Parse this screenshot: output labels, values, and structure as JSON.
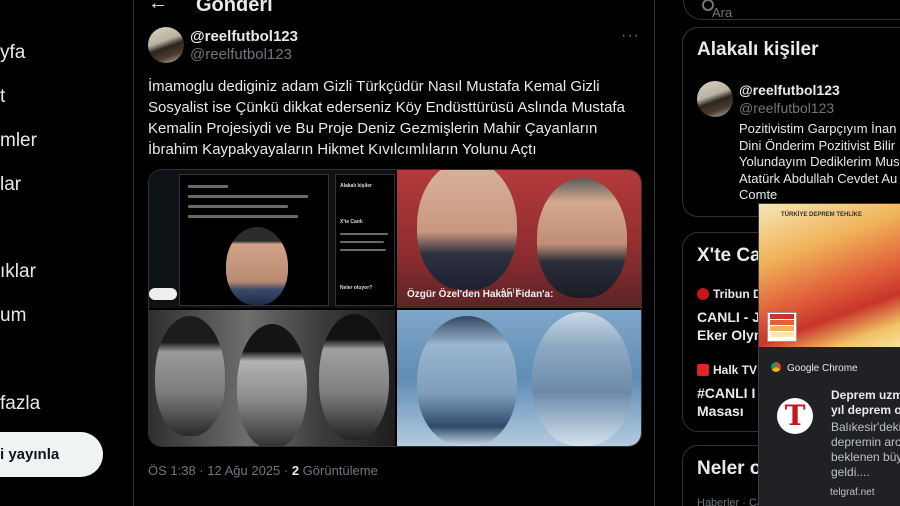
{
  "nav": {
    "items": [
      "yfa",
      "t",
      "mler",
      "lar",
      "ıklar",
      "um",
      "fazla"
    ],
    "post_button": "i yayınla"
  },
  "header": {
    "title": "Gönderi"
  },
  "tweet": {
    "display_name": "@reelfutbol123",
    "handle": "@reelfutbol123",
    "text_lines": [
      "İmamoglu dediginiz adam  Gizli Türkçüdür  Nasıl Mustafa Kemal Gizli",
      "Sosyalist ise  Çünkü dikkat ederseniz Köy Endüsttürüsü Aslında Mustafa",
      "Kemalin Projesiydi  ve Bu Proje Deniz Gezmişlerin Mahir Çayanların",
      "İbrahim Kaypakyayaların  Hikmet Kıvılcımlıların Yolunu Açtı"
    ],
    "time": "ÖS 1:38 · 12 Ağu 2025 · ",
    "views_count": "2",
    "views_label": " Görüntüleme",
    "media": {
      "p2_logo": "AÇIK",
      "p2_caption": "Özgür Özel'den Hakan Fidan'a:",
      "p1_panel_title": "Alakalı kişiler",
      "p1_panel_sub": "X'te Canlı",
      "p1_panel_q": "Neler oluyor?"
    }
  },
  "search": {
    "placeholder": "Ara"
  },
  "related": {
    "title": "Alakalı kişiler",
    "display_name": "@reelfutbol123",
    "handle": "@reelfutbol123",
    "bio_lines": [
      "Pozitivistim Garpçıyım İnan",
      "Dini Önderim Pozitivist Bilir",
      "Yolundayım Dediklerim Mus",
      "Atatürk Abdullah Cevdet Au",
      "Comte"
    ]
  },
  "live": {
    "title": "X'te Ca",
    "items": [
      {
        "source": "Tribun D",
        "title_lines": [
          "CANLI - J7",
          "Eker Olym"
        ],
        "color": "#c4161c"
      },
      {
        "source": "Halk TV",
        "title_lines": [
          "#CANLI I S",
          "Masası"
        ],
        "color": "#e0242a"
      }
    ]
  },
  "whats_happening": {
    "title": "Neler o",
    "sub": "Haberler · Ca"
  },
  "notification": {
    "app": "Google Chrome",
    "map_title": "TÜRKİYE DEPREM TEHLİKE",
    "logo_letter": "T",
    "title_lines": [
      "Deprem uzm",
      "yıl deprem ol"
    ],
    "body_lines": [
      "Balıkesir'deki",
      "depremin arc",
      "beklenen büy",
      "geldi...."
    ],
    "source": "telgraf.net",
    "legend_colors": [
      "#c8352a",
      "#e1603a",
      "#f0b35a",
      "#f5e7b8"
    ]
  }
}
